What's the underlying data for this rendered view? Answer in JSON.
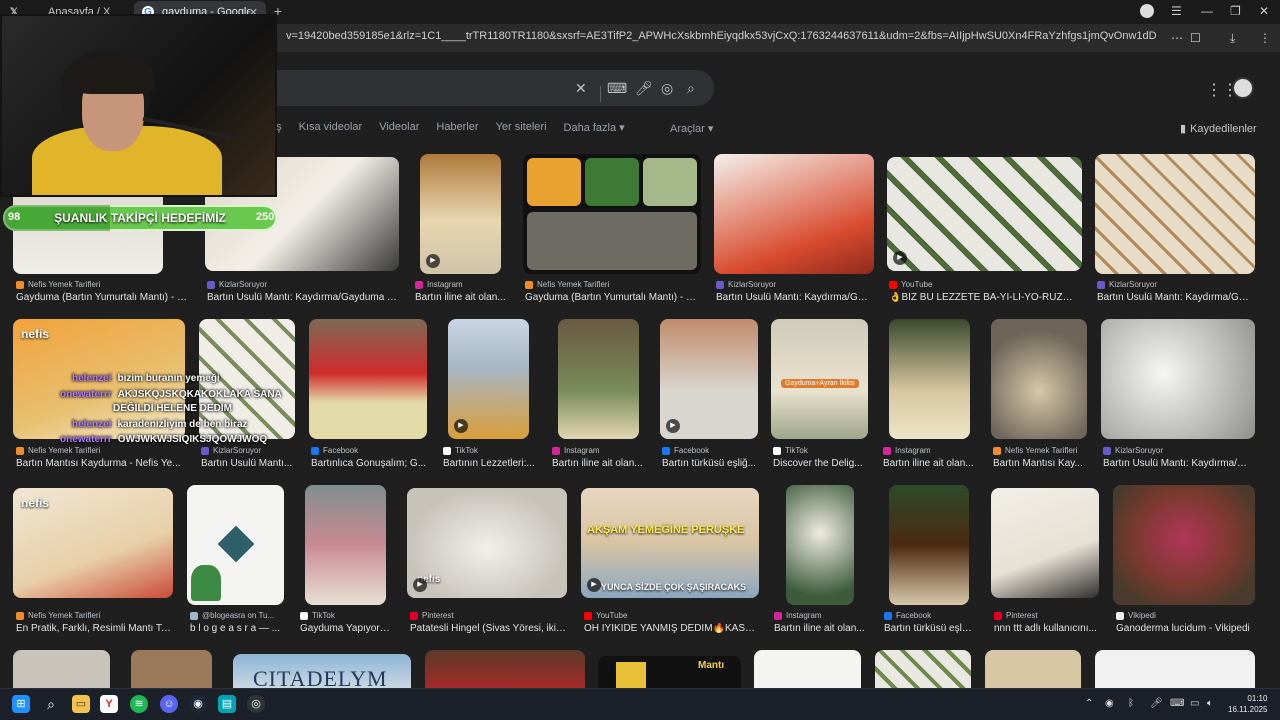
{
  "browser": {
    "tabs": [
      {
        "label": "Anasayfa / X",
        "icon": "x-logo-icon"
      },
      {
        "label": "gayduma - Google'da A",
        "icon": "google-icon"
      }
    ],
    "url": "v=19420bed359185e1&rlz=1C1____trTR1180TR1180&sxsrf=AE3TifP2_APWHcXskbmhEiyqdkx53vjCxQ:1763244637611&udm=2&fbs=AIIjpHwSU0Xn4FRaYzhfgs1jmQvOnw1dDD9iiBuIB..."
  },
  "search": {
    "nav": [
      "riş",
      "Kısa videolar",
      "Videolar",
      "Haberler",
      "Yer siteleri",
      "Daha fazla ▾"
    ],
    "tools": "Araçlar ▾",
    "saved": "Kaydedilenler"
  },
  "overlay": {
    "goal_label": "ŞUANLIK TAKİPÇİ HEDEFİMİZ",
    "goal_current": "98",
    "goal_target": "250",
    "goal_progress": 0.39,
    "chat": [
      {
        "user": "helenzei",
        "msg": "bizim buranın yemeği"
      },
      {
        "user": "onewaterrr",
        "msg": "AKJSKQJSKQKAKOKLAKA SANA"
      },
      {
        "user": "",
        "msg": "DEĞİLDİ HELENE DEDİM"
      },
      {
        "user": "helenzei",
        "msg": "karadenizliyim de ben biraz"
      },
      {
        "user": "onewaterrr",
        "msg": "OWJWKWJSIQIKSJQOWJWOQ"
      }
    ]
  },
  "results": {
    "row1": [
      {
        "source": "Nefis Yemek Tarifleri",
        "title": "Gayduma (Bartın Yumurtalı Mantı) - N..."
      },
      {
        "source": "KizlarSoruyor",
        "title": "Bartın Usulü Mantı: Kaydırma/Gayduma T..."
      },
      {
        "source": "Instagram",
        "title": "Bartın iline ait olan..."
      },
      {
        "source": "Nefis Yemek Tarifleri",
        "title": "Gayduma (Bartın Yumurtalı Mantı) - N..."
      },
      {
        "source": "KizlarSoruyor",
        "title": "Bartın Usulü Mantı: Kaydırma/Ga..."
      },
      {
        "source": "YouTube",
        "title": "👌BİZ BU LEZZETE BA-YI-LI-YO-RUZ😊..."
      },
      {
        "source": "KizlarSoruyor",
        "title": "Bartın Usulü Mantı: Kaydırma/Ga..."
      }
    ],
    "row2": [
      {
        "source": "Nefis Yemek Tarifleri",
        "title": "Bartın Mantısı Kaydurma - Nefis Ye..."
      },
      {
        "source": "KizlarSoruyor",
        "title": "Bartın Usulü Mantı..."
      },
      {
        "source": "Facebook",
        "title": "Bartınlıca Gonuşalım; G..."
      },
      {
        "source": "TikTok",
        "title": "Bartının Lezzetleri:..."
      },
      {
        "source": "Instagram",
        "title": "Bartın iline ait olan..."
      },
      {
        "source": "Facebook",
        "title": "Bartın türküsü eşliğ..."
      },
      {
        "source": "TikTok",
        "title": "Discover the Delig..."
      },
      {
        "source": "Instagram",
        "title": "Bartın iline ait olan..."
      },
      {
        "source": "Nefis Yemek Tarifleri",
        "title": "Bartın Mantısı Kay..."
      },
      {
        "source": "KizlarSoruyor",
        "title": "Bartın Usulü Mantı: Kaydırma/G..."
      }
    ],
    "row3": [
      {
        "source": "Nefis Yemek Tarifleri",
        "title": "En Pratik, Farklı, Resimli Mantı Ta..."
      },
      {
        "source": "@blogeasra on Tu...",
        "title": "b l o g e a s r a — ..."
      },
      {
        "source": "TikTok",
        "title": "Gayduma Yapıyoru..."
      },
      {
        "source": "Pinterest",
        "title": "Patatesli Hingel (Sivas Yöresi, iki ..."
      },
      {
        "source": "YouTube",
        "title": "OH İYİKİDE YANMIŞ DEDİM🔥KAST..."
      },
      {
        "source": "Instagram",
        "title": "Bartın iline ait olan..."
      },
      {
        "source": "Facebook",
        "title": "Bartın türküsü eşli..."
      },
      {
        "source": "Pinterest",
        "title": "nnn ttt adlı kullanıcını..."
      },
      {
        "source": "Vikipedi",
        "title": "Ganoderma lucidum - Vikipedi"
      }
    ],
    "thumb_texts": {
      "nefis": "nefis",
      "aksam": "AKŞAM YEMEĞİNE PERUŞKE",
      "yunca": "YUNCA SİZDE ÇOK ŞAŞIRACAKS",
      "ayran": "Gayduma+Ayran İkilisi",
      "citadel": "CITADELYM",
      "manti": "Mantı"
    }
  },
  "taskbar": {
    "time": "01:10",
    "date": "16.11.2025"
  },
  "colors": {
    "goal_green": "#69c94e",
    "chat_name": "#b47cff"
  }
}
